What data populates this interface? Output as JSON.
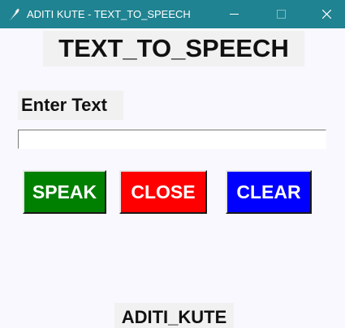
{
  "window": {
    "title": "ADITI KUTE - TEXT_TO_SPEECH",
    "app_icon": "feather-icon",
    "controls": [
      "minimize-icon",
      "maximize-icon",
      "close-icon"
    ]
  },
  "app": {
    "heading": "TEXT_TO_SPEECH",
    "input_label": "Enter Text",
    "input_value": "",
    "buttons": {
      "speak": "SPEAK",
      "close": "CLOSE",
      "clear": "CLEAR"
    },
    "footer": "ADITI_KUTE"
  },
  "colors": {
    "titlebar": "#1f8391",
    "background": "#f8f8fe",
    "speak": "#008000",
    "close": "#ff0000",
    "clear": "#0000ff"
  }
}
